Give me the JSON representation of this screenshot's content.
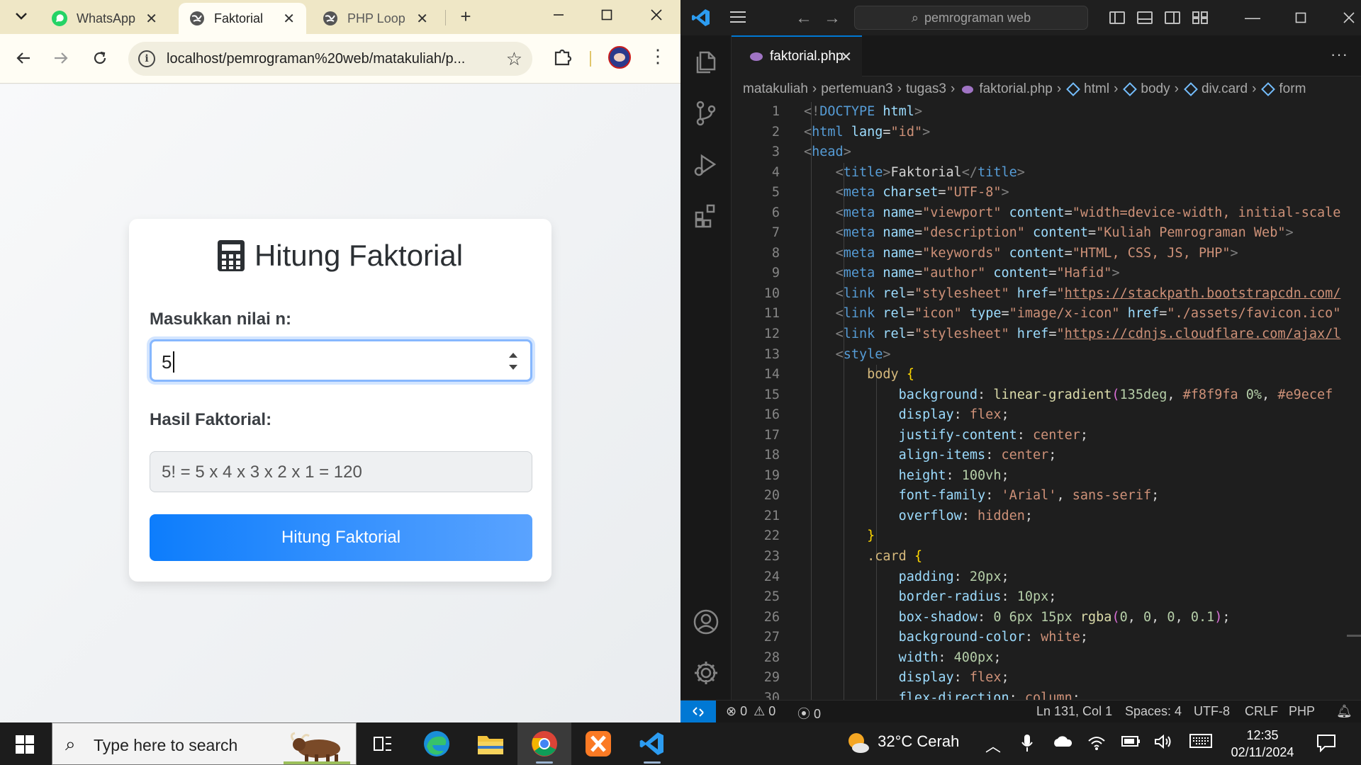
{
  "browser": {
    "tabs": [
      {
        "title": "WhatsApp",
        "icon": "whatsapp-icon",
        "active": false
      },
      {
        "title": "Faktorial",
        "icon": "globe-icon",
        "active": true
      },
      {
        "title": "PHP Loop",
        "icon": "globe-icon",
        "active": false
      }
    ],
    "url": "localhost/pemrograman%20web/matakuliah/p..."
  },
  "app": {
    "title": "Hitung Faktorial",
    "input_label": "Masukkan nilai n:",
    "input_value": "5",
    "result_label": "Hasil Faktorial:",
    "result_value": "5! = 5 x 4 x 3 x 2 x 1 = 120",
    "button_label": "Hitung Faktorial",
    "accent": "#0d7dfc"
  },
  "vscode": {
    "search": "pemrograman web",
    "tab": "faktorial.php",
    "breadcrumbs": [
      "matakuliah",
      "pertemuan3",
      "tugas3",
      "faktorial.php",
      "html",
      "body",
      "div.card",
      "form"
    ],
    "line_numbers": [
      "1",
      "2",
      "3",
      "4",
      "5",
      "6",
      "7",
      "8",
      "9",
      "10",
      "11",
      "12",
      "13",
      "14",
      "15",
      "16",
      "17",
      "18",
      "19",
      "20",
      "21",
      "22",
      "23",
      "24",
      "25",
      "26",
      "27",
      "28",
      "29",
      "30"
    ],
    "code_text": {
      "doctype": "DOCTYPE",
      "title_text": "Faktorial",
      "charset": "\"UTF-8\"",
      "lang": "\"id\"",
      "viewport": "\"viewport\"",
      "viewport_content": "\"width=device-width, initial-scale",
      "description": "\"description\"",
      "description_content": "\"Kuliah Pemrograman Web\"",
      "keywords": "\"keywords\"",
      "keywords_content": "\"HTML, CSS, JS, PHP\"",
      "author": "\"author\"",
      "author_content": "\"Hafid\"",
      "stylesheet": "\"stylesheet\"",
      "bootstrap_href": "https://stackpath.bootstrapcdn.com/",
      "icon_rel": "\"icon\"",
      "icon_type": "\"image/x-icon\"",
      "favicon_href": "\"./assets/favicon.ico\"",
      "cloudflare_href": "https://cdnjs.cloudflare.com/ajax/l"
    },
    "status": {
      "errors": "0",
      "warnings": "0",
      "ports": "0",
      "position": "Ln 131, Col 1",
      "spaces": "Spaces: 4",
      "encoding": "UTF-8",
      "eol": "CRLF",
      "language": "PHP"
    }
  },
  "taskbar": {
    "search_placeholder": "Type here to search",
    "weather": "32°C  Cerah",
    "time": "12:35",
    "date": "02/11/2024"
  }
}
